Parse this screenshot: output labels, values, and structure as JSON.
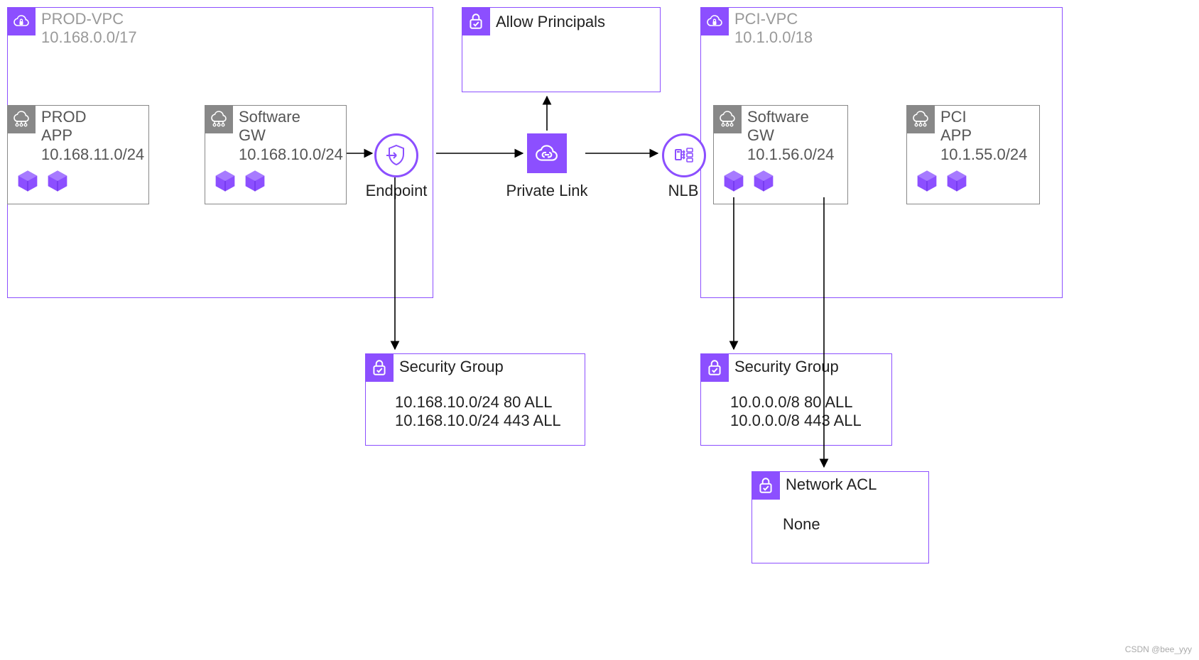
{
  "vpc_left": {
    "name": "PROD-VPC",
    "cidr": "10.168.0.0/17"
  },
  "vpc_right": {
    "name": "PCI-VPC",
    "cidr": "10.1.0.0/18"
  },
  "subnets": {
    "prod_app": {
      "line1": "PROD",
      "line2": "APP",
      "cidr": "10.168.11.0/24"
    },
    "prod_gw": {
      "line1": "Software",
      "line2": "GW",
      "cidr": "10.168.10.0/24"
    },
    "pci_gw": {
      "line1": "Software",
      "line2": "GW",
      "cidr": "10.1.56.0/24"
    },
    "pci_app": {
      "line1": "PCI",
      "line2": "APP",
      "cidr": "10.1.55.0/24"
    }
  },
  "nodes": {
    "endpoint": "Endpoint",
    "privatelink": "Private Link",
    "nlb": "NLB"
  },
  "allow_principals": {
    "title": "Allow Principals"
  },
  "sg_left": {
    "title": "Security Group",
    "rules": [
      "10.168.10.0/24 80 ALL",
      "10.168.10.0/24 443 ALL"
    ]
  },
  "sg_right": {
    "title": "Security Group",
    "rules": [
      "10.0.0.0/8 80 ALL",
      "10.0.0.0/8 443 ALL"
    ]
  },
  "nacl": {
    "title": "Network ACL",
    "body": "None"
  },
  "watermark": "CSDN @bee_yyy"
}
